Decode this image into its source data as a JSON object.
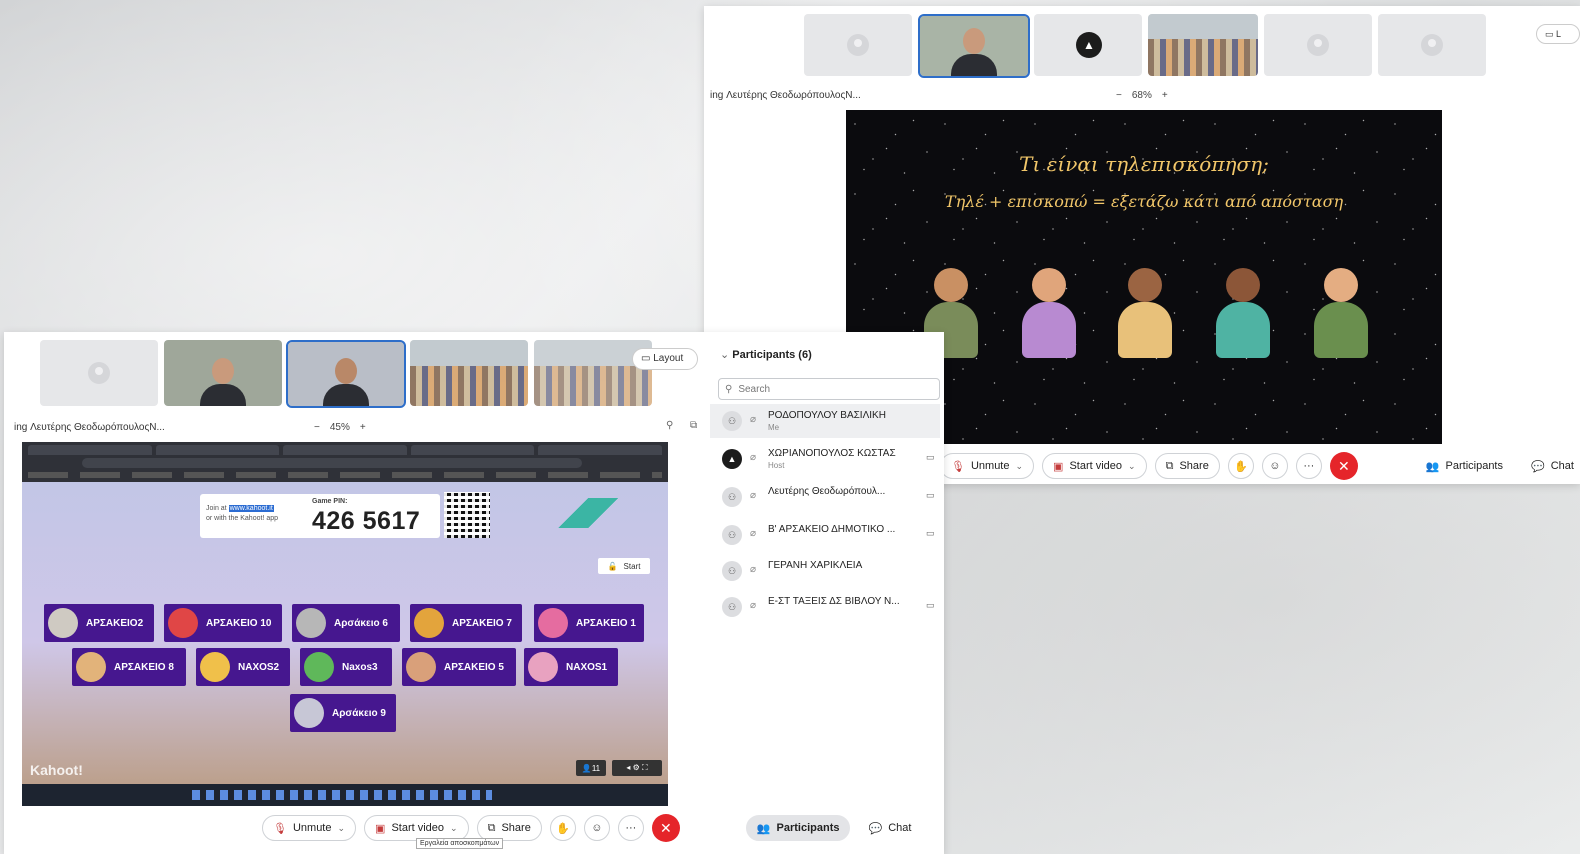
{
  "right_window": {
    "caption": "ing Λευτέρης ΘεοδωρόπουλοςΝ...",
    "zoom": {
      "minus": "−",
      "value": "68%",
      "plus": "+"
    },
    "layout_label": "L",
    "slide": {
      "title": "Τι είναι τηλεπισκόπηση;",
      "subtitle": "Τηλέ + επισκοπώ = εξετάζω κάτι από απόσταση"
    },
    "toolbar": {
      "unmute": "Unmute",
      "start_video": "Start video",
      "share": "Share",
      "more": "···",
      "end": "✕",
      "participants": "Participants",
      "chat": "Chat"
    }
  },
  "left_window": {
    "layout_label": "Layout",
    "caption": "ing Λευτέρης ΘεοδωρόπουλοςΝ...",
    "zoom": {
      "minus": "−",
      "value": "45%",
      "plus": "+"
    },
    "kahoot": {
      "join_line1": "Join at",
      "join_url": "www.kahoot.it",
      "join_line2": "or with the Kahoot! app",
      "pin_label": "Game PIN:",
      "pin": "426 5617",
      "start": "Start",
      "logo": "Kahoot!",
      "player_count": "11",
      "players_row1": [
        "ΑΡΣΑΚΕΙΟ2",
        "ΑΡΣΑΚΕΙΟ 10",
        "Αρσάκειο 6",
        "ΑΡΣΑΚΕΙΟ 7",
        "ΑΡΣΑΚΕΙΟ 1"
      ],
      "players_row2": [
        "ΑΡΣΑΚΕΙΟ 8",
        "NAXOS2",
        "Naxos3",
        "ΑΡΣΑΚΕΙΟ 5",
        "NAXOS1"
      ],
      "players_row3": [
        "Αρσάκειο 9"
      ]
    },
    "toolbar": {
      "unmute": "Unmute",
      "start_video": "Start video",
      "share": "Share",
      "more": "···",
      "end": "✕",
      "participants": "Participants",
      "chat": "Chat",
      "tooltip": "Εργαλεία αποσκοπμάτων"
    },
    "panel": {
      "title": "Participants (6)",
      "search_placeholder": "Search",
      "rows": [
        {
          "name": "ΡΟΔΟΠΟΥΛΟΥ ΒΑΣΙΛΙΚΗ",
          "role": "Me"
        },
        {
          "name": "ΧΩΡΙΑΝΟΠΟΥΛΟΣ ΚΩΣΤΑΣ",
          "role": "Host"
        },
        {
          "name": "Λευτέρης Θεοδωρόπουλ...",
          "role": ""
        },
        {
          "name": "Β' ΑΡΣΑΚΕΙΟ ΔΗΜΟΤΙΚΟ ...",
          "role": ""
        },
        {
          "name": "ΓΕΡΑΝΗ ΧΑΡΙΚΛΕΙΑ",
          "role": ""
        },
        {
          "name": "Ε-ΣΤ ΤΑΞΕΙΣ ΔΣ ΒΙΒΛΟΥ Ν...",
          "role": ""
        }
      ]
    }
  },
  "colors": {
    "accent": "#2e6ec9",
    "end_call": "#e5252a",
    "kahoot_purple": "#46178f",
    "slide_text": "#f2c76a"
  }
}
